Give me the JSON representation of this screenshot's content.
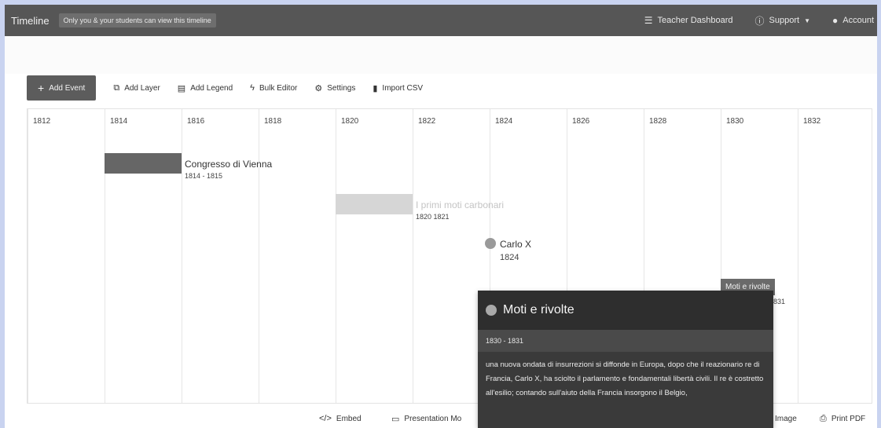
{
  "header": {
    "title": "Timeline",
    "privacy_badge": "Only you & your students can view this timeline",
    "teacher_dashboard": "Teacher Dashboard",
    "support": "Support",
    "account": "Account"
  },
  "toolbar": {
    "add_event": "Add Event",
    "add_layer": "Add Layer",
    "add_legend": "Add Legend",
    "bulk_editor": "Bulk Editor",
    "settings": "Settings",
    "import_csv": "Import CSV"
  },
  "timeline": {
    "years": [
      "1812",
      "1814",
      "1816",
      "1818",
      "1820",
      "1822",
      "1824",
      "1826",
      "1828",
      "1830",
      "1832"
    ],
    "events": [
      {
        "title": "Congresso di Vienna",
        "dates": "1814 - 1815",
        "color": "#666666"
      },
      {
        "title": "I primi moti carbonari",
        "dates": "1820   1821",
        "color": "#d6d6d6"
      },
      {
        "title": "Carlo X",
        "dates": "1824",
        "color": "#9a9a9a"
      },
      {
        "title": "Moti e rivolte",
        "dates": "1831",
        "color": "#6a6a6a"
      }
    ]
  },
  "popup": {
    "title": "Moti e rivolte",
    "dates": "1830 - 1831",
    "description": "una nuova ondata di insurrezioni si diffonde in Europa, dopo che il reazionario re di Francia, Carlo X, ha sciolto il parlamento e fondamentali libertà civili. Il re è costretto all'esilio; contando sull'aiuto della Francia insorgono il Belgio,"
  },
  "footer": {
    "embed": "Embed",
    "presentation_mode": "Presentation Mo",
    "image": "Image",
    "print_pdf": "Print PDF"
  },
  "colors": {
    "topbar": "#565656",
    "accent_dark": "#5c5c5c",
    "popup_bg": "#3a3a3a"
  }
}
